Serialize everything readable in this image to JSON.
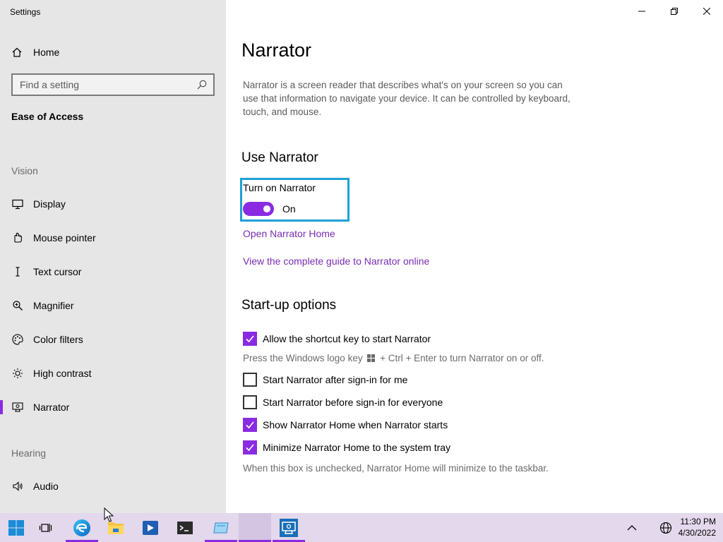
{
  "app": {
    "title": "Settings"
  },
  "sidebar": {
    "home_label": "Home",
    "search_placeholder": "Find a setting",
    "section_title": "Ease of Access",
    "group_vision": "Vision",
    "group_hearing": "Hearing",
    "items": [
      {
        "label": "Display",
        "icon": "monitor-icon"
      },
      {
        "label": "Mouse pointer",
        "icon": "mouse-pointer-icon"
      },
      {
        "label": "Text cursor",
        "icon": "text-cursor-icon"
      },
      {
        "label": "Magnifier",
        "icon": "magnifier-icon"
      },
      {
        "label": "Color filters",
        "icon": "color-filters-icon"
      },
      {
        "label": "High contrast",
        "icon": "high-contrast-icon"
      },
      {
        "label": "Narrator",
        "icon": "narrator-icon",
        "active": true
      },
      {
        "label": "Audio",
        "icon": "speaker-icon"
      }
    ]
  },
  "main": {
    "title": "Narrator",
    "description": "Narrator is a screen reader that describes what's on your screen so you can use that information to navigate your device. It can be controlled by keyboard, touch, and mouse.",
    "use_heading": "Use Narrator",
    "toggle_label": "Turn on Narrator",
    "toggle_state": "On",
    "toggle_on": true,
    "link_home": "Open Narrator Home",
    "link_guide": "View the complete guide to Narrator online",
    "startup_heading": "Start-up options",
    "options": [
      {
        "label": "Allow the shortcut key to start Narrator",
        "checked": true
      },
      {
        "label": "Start Narrator after sign-in for me",
        "checked": false
      },
      {
        "label": "Start Narrator before sign-in for everyone",
        "checked": false
      },
      {
        "label": "Show Narrator Home when Narrator starts",
        "checked": true
      },
      {
        "label": "Minimize Narrator Home to the system tray",
        "checked": true
      }
    ],
    "shortcut_hint_prefix": "Press the Windows logo key",
    "shortcut_hint_suffix": "+ Ctrl + Enter to turn Narrator on or off.",
    "minimize_hint": "When this box is unchecked, Narrator Home will minimize to the taskbar."
  },
  "taskbar": {
    "time": "11:30 PM",
    "date": "4/30/2022"
  },
  "colors": {
    "accent": "#8a2be2",
    "link": "#7a2cb0",
    "highlight_border": "#1ea0d5",
    "sidebar_bg": "#e6e6e6",
    "taskbar_bg": "#e3d8ec"
  }
}
